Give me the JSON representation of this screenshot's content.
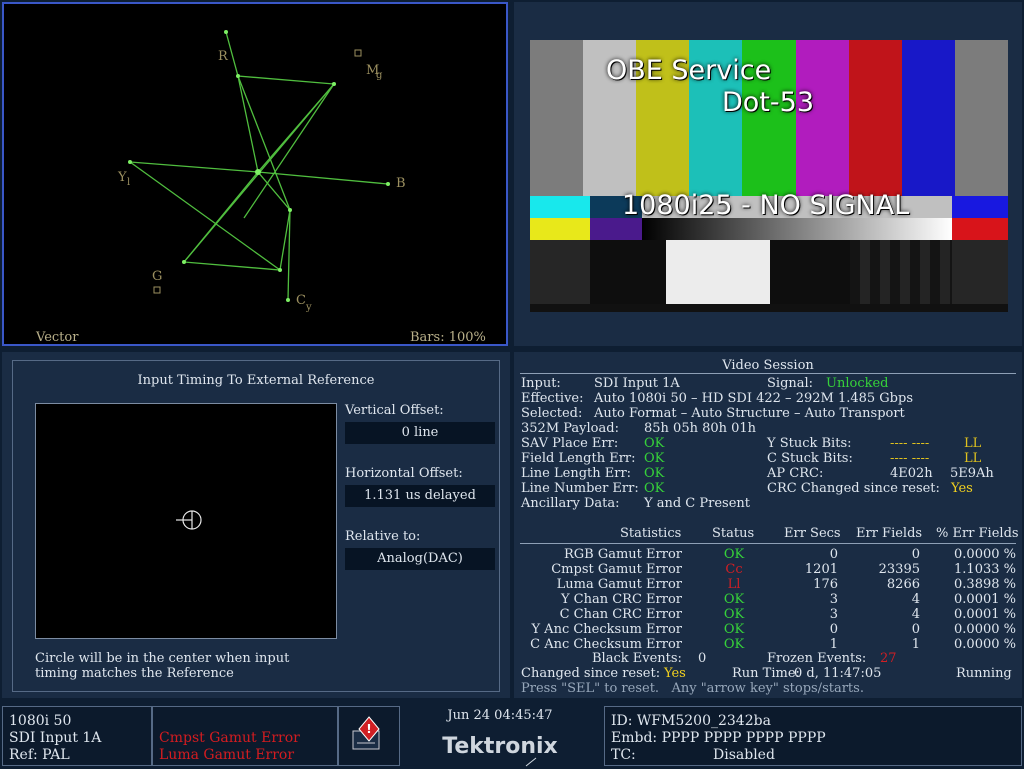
{
  "vector": {
    "title": "Vector",
    "bars": "Bars: 100%",
    "targets": {
      "r": "R",
      "mg": "M",
      "mg_sub": "g",
      "b": "B",
      "yl": "Y",
      "yl_sub": "l",
      "g": "G",
      "cy": "C",
      "cy_sub": "y"
    }
  },
  "picture": {
    "overlay_service": "OBE Service",
    "overlay_name": "Dot-53",
    "overlay_signal": "1080i25 - NO SIGNAL",
    "bar_colors": [
      "#7c7c7c",
      "#c0c0c0",
      "#c0c01a",
      "#1cc0b8",
      "#1cc01a",
      "#b11cbe",
      "#c0141a",
      "#1818c8",
      "#7c7c7c"
    ]
  },
  "timing": {
    "title": "Input Timing To External Reference",
    "vertical_label": "Vertical Offset:",
    "vertical_value": "0 line",
    "horizontal_label": "Horizontal Offset:",
    "horizontal_value": "1.131 us delayed",
    "relative_label": "Relative to:",
    "relative_value": "Analog(DAC)",
    "note_line1": "Circle will be in the center when input",
    "note_line2": "timing matches the Reference"
  },
  "session": {
    "title": "Video Session",
    "input_label": "Input:",
    "input_value": "SDI Input 1A",
    "signal_label": "Signal:",
    "signal_value": "Unlocked",
    "effective_label": "Effective:",
    "effective_value": "Auto 1080i 50 – HD SDI 422 – 292M 1.485 Gbps",
    "selected_label": "Selected:",
    "selected_value": "Auto Format – Auto Structure – Auto Transport",
    "payload_label": "352M Payload:",
    "payload_value": "85h 05h 80h 01h",
    "sav_label": "SAV Place Err:",
    "sav_value": "OK",
    "field_label": "Field Length Err:",
    "field_value": "OK",
    "line_len_label": "Line Length Err:",
    "line_len_value": "OK",
    "line_num_label": "Line Number Err:",
    "line_num_value": "OK",
    "anc_label": "Ancillary Data:",
    "anc_value": "Y and C Present",
    "ystuck_label": "Y Stuck Bits:",
    "ystuck_dash": "---- ----",
    "ystuck_value": "LL",
    "cstuck_label": "C Stuck Bits:",
    "cstuck_dash": "---- ----",
    "cstuck_value": "LL",
    "apcrc_label": "AP CRC:",
    "apcrc_v1": "4E02h",
    "apcrc_v2": "5E9Ah",
    "crcchg_label": "CRC Changed since reset:",
    "crcchg_value": "Yes",
    "headers": [
      "Statistics",
      "Status",
      "Err Secs",
      "Err Fields",
      "% Err Fields"
    ],
    "rows": [
      {
        "name": "RGB Gamut Error",
        "status": "OK",
        "secs": "0",
        "fields": "0",
        "pct": "0.0000 %"
      },
      {
        "name": "Cmpst Gamut Error",
        "status": "Cc",
        "secs": "1201",
        "fields": "23395",
        "pct": "1.1033 %"
      },
      {
        "name": "Luma Gamut Error",
        "status": "Ll",
        "secs": "176",
        "fields": "8266",
        "pct": "0.3898 %"
      },
      {
        "name": "Y Chan CRC Error",
        "status": "OK",
        "secs": "3",
        "fields": "4",
        "pct": "0.0001 %"
      },
      {
        "name": "C Chan CRC Error",
        "status": "OK",
        "secs": "3",
        "fields": "4",
        "pct": "0.0001 %"
      },
      {
        "name": "Y Anc Checksum Error",
        "status": "OK",
        "secs": "0",
        "fields": "0",
        "pct": "0.0000 %"
      },
      {
        "name": "C Anc Checksum Error",
        "status": "OK",
        "secs": "1",
        "fields": "1",
        "pct": "0.0000 %"
      }
    ],
    "black_label": "Black Events:",
    "black_value": "0",
    "frozen_label": "Frozen Events:",
    "frozen_value": "27",
    "changed_label": "Changed since reset:",
    "changed_value": "Yes",
    "runtime_label": "Run Time:",
    "runtime_value": "0 d, 11:47:05",
    "running": "Running",
    "hint": "Press \"SEL\" to reset.   Any \"arrow key\" stops/starts."
  },
  "status": {
    "format": "1080i 50",
    "input": "SDI Input 1A",
    "ref": "Ref: PAL",
    "error1": "Cmpst Gamut Error",
    "error2": "Luma Gamut Error",
    "datetime": "Jun 24 04:45:47",
    "brand": "Tektronix",
    "id": "ID: WFM5200_2342ba",
    "embd": "Embd: PPPP PPPP PPPP PPPP",
    "tc_label": "TC:",
    "tc_value": "Disabled"
  }
}
